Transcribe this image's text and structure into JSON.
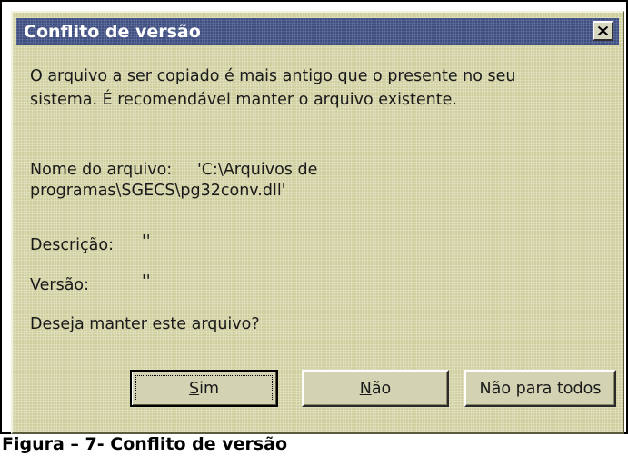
{
  "dialog": {
    "title": "Conflito de versão",
    "close_label": "X",
    "message_line_1": "O arquivo a ser copiado é mais antigo que o presente no seu",
    "message_line_2": "sistema.  É recomendável manter o arquivo existente.",
    "filename_line_1": "Nome do arquivo:     'C:\\Arquivos de",
    "filename_line_2": "programas\\SGECS\\pg32conv.dll'",
    "description_label": "Descrição:",
    "description_value": "''",
    "version_label": "Versão:",
    "version_value": "''",
    "question": "Deseja manter este arquivo?",
    "buttons": {
      "yes": {
        "mnemonic": "S",
        "rest": "im"
      },
      "no": {
        "mnemonic": "N",
        "rest": "ão"
      },
      "no_to_all": {
        "label": "Não para todos"
      }
    }
  },
  "caption": "Figura – 7- Conflito de versão"
}
